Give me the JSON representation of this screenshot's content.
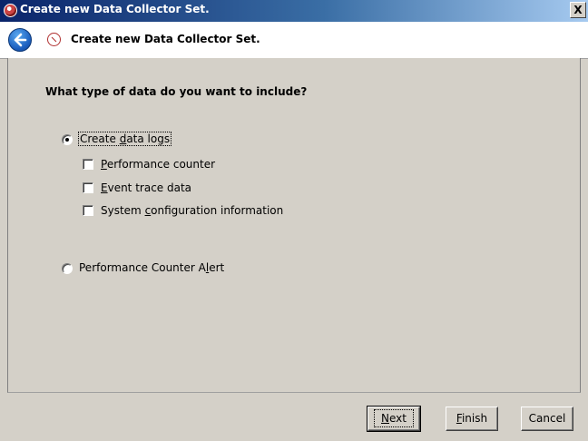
{
  "window": {
    "title": "Create new Data Collector Set.",
    "close_glyph": "X"
  },
  "header": {
    "back_icon": "back-arrow-icon",
    "title": "Create new Data Collector Set."
  },
  "content": {
    "question": "What type of data do you want to include?",
    "options": {
      "create_logs": {
        "label_pre": "Create ",
        "label_u": "d",
        "label_post": "ata logs",
        "selected": true
      },
      "performance_counter": {
        "label_pre": "",
        "label_u": "P",
        "label_post": "erformance counter",
        "checked": false
      },
      "event_trace": {
        "label_pre": "",
        "label_u": "E",
        "label_post": "vent trace data",
        "checked": false
      },
      "system_config": {
        "label_pre": "System ",
        "label_u": "c",
        "label_post": "onfiguration information",
        "checked": false
      },
      "alert": {
        "label_pre": "Performance Counter A",
        "label_u": "l",
        "label_post": "ert",
        "selected": false
      }
    }
  },
  "buttons": {
    "next": {
      "label_u": "N",
      "label_post": "ext"
    },
    "finish": {
      "label_u": "F",
      "label_post": "inish"
    },
    "cancel": {
      "label": "Cancel"
    }
  }
}
